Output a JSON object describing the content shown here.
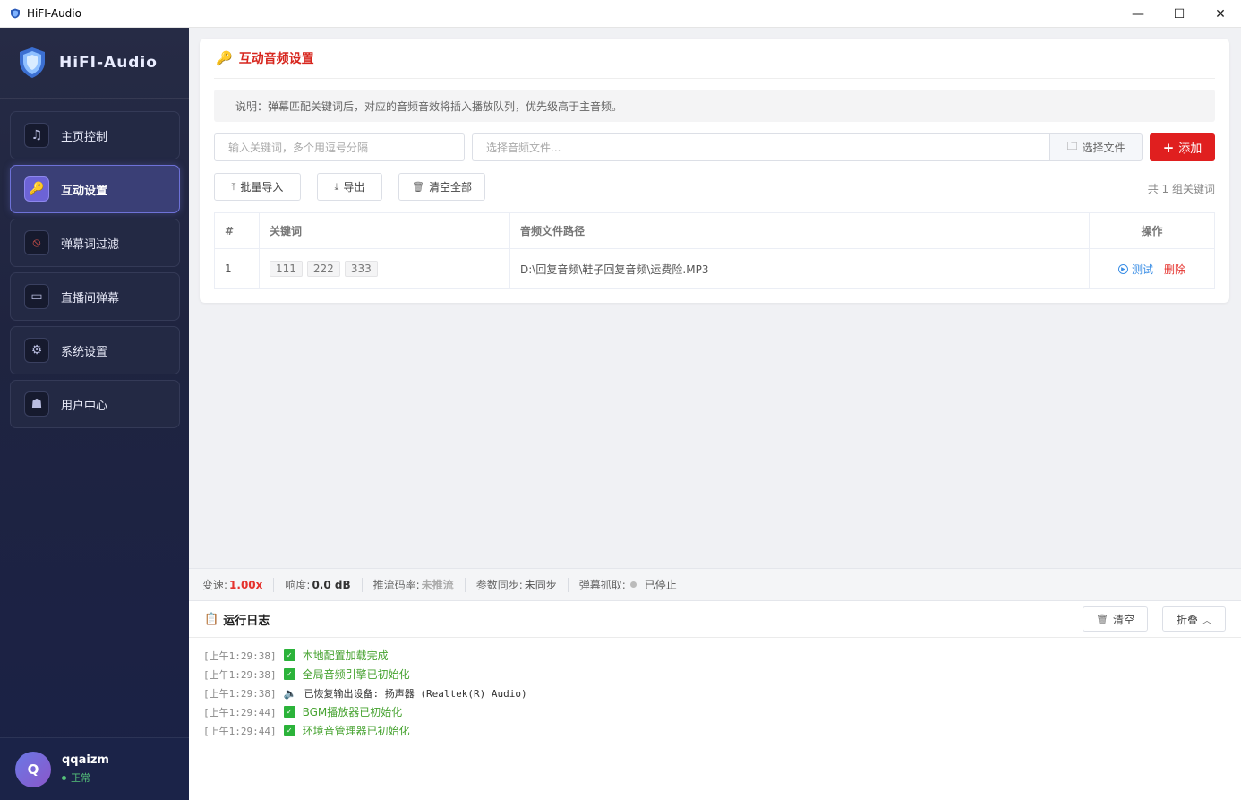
{
  "window": {
    "title": "HiFI-Audio",
    "minimize": "—",
    "maximize": "☐",
    "close": "✕"
  },
  "brand": {
    "name": "HiFI-Audio"
  },
  "sidebar": {
    "items": [
      {
        "label": "主页控制",
        "icon": "♫"
      },
      {
        "label": "互动设置",
        "icon": "🔑"
      },
      {
        "label": "弹幕词过滤",
        "icon": "⦸"
      },
      {
        "label": "直播间弹幕",
        "icon": "▭"
      },
      {
        "label": "系统设置",
        "icon": "⚙"
      },
      {
        "label": "用户中心",
        "icon": "☗"
      }
    ],
    "active_index": 1
  },
  "user": {
    "initial": "Q",
    "name": "qqaizm",
    "status": "正常"
  },
  "card": {
    "title": "互动音频设置",
    "description": "说明：弹幕匹配关键词后，对应的音频音效将插入播放队列，优先级高于主音频。",
    "keyword_placeholder": "输入关键词，多个用逗号分隔",
    "file_placeholder": "选择音频文件...",
    "choose_file_label": "选择文件",
    "add_label": "添加",
    "batch_import_label": "批量导入",
    "export_label": "导出",
    "clear_all_label": "清空全部",
    "count_text": "共 1 组关键词"
  },
  "table": {
    "headers": [
      "#",
      "关键词",
      "音频文件路径",
      "操作"
    ],
    "rows": [
      {
        "index": "1",
        "keywords": [
          "111",
          "222",
          "333"
        ],
        "path": "D:\\回复音频\\鞋子回复音频\\运费险.MP3",
        "test_label": "测试",
        "delete_label": "删除"
      }
    ]
  },
  "statusbar": {
    "speed_label": "变速:",
    "speed_value": "1.00x",
    "volume_label": "响度:",
    "volume_value": "0.0 dB",
    "stream_label": "推流码率:",
    "stream_value": "未推流",
    "sync_label": "参数同步:",
    "sync_value": "未同步",
    "danmaku_label": "弹幕抓取:",
    "danmaku_value": "已停止"
  },
  "log": {
    "title": "运行日志",
    "clear_label": "清空",
    "fold_label": "折叠",
    "lines": [
      {
        "time": "[上午1:29:38]",
        "type": "check",
        "text": "本地配置加载完成"
      },
      {
        "time": "[上午1:29:38]",
        "type": "check",
        "text": "全局音频引擎已初始化"
      },
      {
        "time": "[上午1:29:38]",
        "type": "speaker",
        "text": "已恢复输出设备: 扬声器 (Realtek(R) Audio)"
      },
      {
        "time": "[上午1:29:44]",
        "type": "check",
        "text": "BGM播放器已初始化"
      },
      {
        "time": "[上午1:29:44]",
        "type": "check",
        "text": "环境音管理器已初始化"
      }
    ]
  },
  "colors": {
    "accent_red": "#e01f1f",
    "active_nav": "#6c63d6",
    "success_green": "#2bb33a",
    "link_blue": "#3a8ee6"
  }
}
